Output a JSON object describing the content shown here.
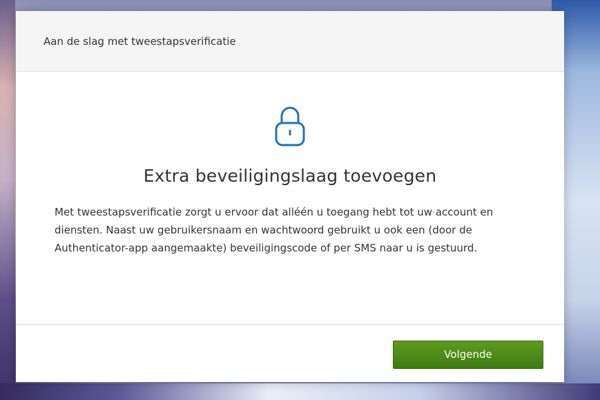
{
  "dialog": {
    "title": "Aan de slag met tweestapsverificatie",
    "icon": "lock-icon",
    "headline": "Extra beveiligingslaag toevoegen",
    "description": "Met tweestapsverificatie zorgt u ervoor dat alléén u toegang hebt tot uw account en diensten. Naast uw gebruikersnaam en wachtwoord gebruikt u ook een (door de Authenticator-app aangemaakte) beveiligingscode of per SMS naar u is gestuurd.",
    "next_label": "Volgende"
  },
  "colors": {
    "accent_icon": "#1f73b7",
    "button_green": "#4a8a14"
  }
}
